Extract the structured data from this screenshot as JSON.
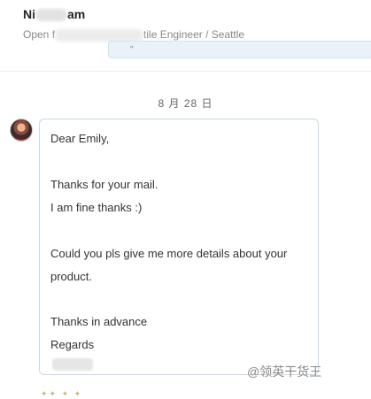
{
  "header": {
    "name_start": "Ni",
    "name_end": "am",
    "headline_start": "Open f",
    "headline_end": "tile Engineer / Seattle",
    "field_mark": "\""
  },
  "date_label": "8 月 28 日",
  "message": {
    "lines": [
      "Dear Emily,",
      "Thanks for your mail.",
      "I am fine thanks :)",
      "Could you pls give me more details about your",
      "product.",
      "Thanks in advance",
      "Regards"
    ]
  },
  "footer": {
    "stars": "✦✦ ✦ ✦"
  },
  "watermark": "@领英干货王"
}
